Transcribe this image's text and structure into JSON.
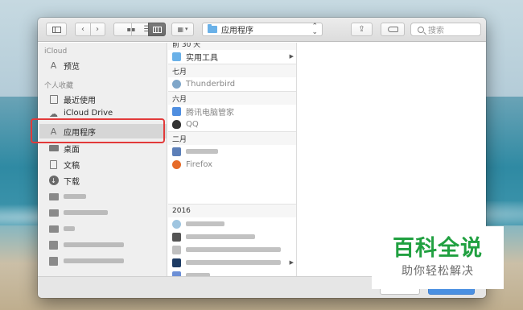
{
  "toolbar": {
    "path_label": "应用程序",
    "search_placeholder": "搜索",
    "view_icons": [
      "grid-view-icon",
      "list-view-icon",
      "column-view-icon"
    ]
  },
  "sidebar": {
    "icloud_heading": "iCloud",
    "icloud_items": [
      {
        "label": "预览",
        "icon": "app-icon"
      }
    ],
    "favorites_heading": "个人收藏",
    "favorites": [
      {
        "label": "最近使用",
        "icon": "recent-icon"
      },
      {
        "label": "iCloud Drive",
        "icon": "cloud-icon"
      },
      {
        "label": "应用程序",
        "icon": "applications-icon",
        "selected": true
      },
      {
        "label": "桌面",
        "icon": "desktop-icon"
      },
      {
        "label": "文稿",
        "icon": "document-icon"
      },
      {
        "label": "下载",
        "icon": "download-icon"
      }
    ]
  },
  "column": {
    "groups": [
      {
        "heading": "前 30 天",
        "items": [
          {
            "label": "实用工具",
            "icon": "folder-icon",
            "has_children": true
          }
        ]
      },
      {
        "heading": "七月",
        "items": [
          {
            "label": "Thunderbird",
            "icon": "thunderbird-icon"
          }
        ]
      },
      {
        "heading": "六月",
        "items": [
          {
            "label": "腾讯电脑管家",
            "icon": "shield-icon"
          },
          {
            "label": "QQ",
            "icon": "qq-icon"
          }
        ]
      },
      {
        "heading": "二月",
        "items": [
          {
            "label": "",
            "icon": "app-icon"
          },
          {
            "label": "Firefox",
            "icon": "firefox-icon"
          }
        ]
      },
      {
        "heading": "2016",
        "items": []
      }
    ]
  },
  "watermark": {
    "main": "百科全说",
    "sub": "助你轻松解决"
  },
  "colors": {
    "highlight": "#e23a3a",
    "watermark_green": "#20a040",
    "folder_blue": "#6ab1e8"
  }
}
